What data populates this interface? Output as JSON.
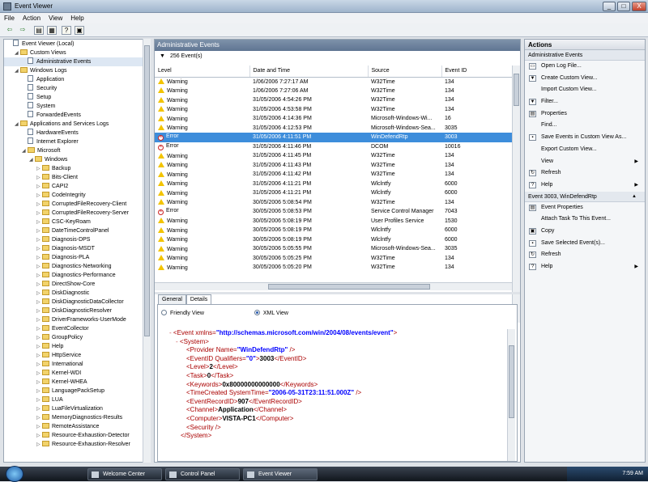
{
  "window": {
    "title": "Event Viewer",
    "minimize": "_",
    "maximize": "□",
    "close": "X"
  },
  "menu": [
    "File",
    "Action",
    "View",
    "Help"
  ],
  "toolbar": {
    "back": "⇦",
    "forward": "⇨",
    "b1": "▤",
    "b2": "▦",
    "b3": "?",
    "b4": "▣"
  },
  "tree": [
    {
      "label": "Event Viewer (Local)",
      "indent": 0,
      "exp": "",
      "kind": "log"
    },
    {
      "label": "Custom Views",
      "indent": 1,
      "exp": "◢",
      "kind": "folder"
    },
    {
      "label": "Administrative Events",
      "indent": 2,
      "exp": "",
      "kind": "log",
      "selected": true
    },
    {
      "label": "Windows Logs",
      "indent": 1,
      "exp": "◢",
      "kind": "folder"
    },
    {
      "label": "Application",
      "indent": 2,
      "exp": "",
      "kind": "log"
    },
    {
      "label": "Security",
      "indent": 2,
      "exp": "",
      "kind": "log"
    },
    {
      "label": "Setup",
      "indent": 2,
      "exp": "",
      "kind": "log"
    },
    {
      "label": "System",
      "indent": 2,
      "exp": "",
      "kind": "log"
    },
    {
      "label": "ForwardedEvents",
      "indent": 2,
      "exp": "",
      "kind": "log"
    },
    {
      "label": "Applications and Services Logs",
      "indent": 1,
      "exp": "◢",
      "kind": "folder"
    },
    {
      "label": "HardwareEvents",
      "indent": 2,
      "exp": "",
      "kind": "log"
    },
    {
      "label": "Internet Explorer",
      "indent": 2,
      "exp": "",
      "kind": "log"
    },
    {
      "label": "Microsoft",
      "indent": 2,
      "exp": "◢",
      "kind": "folder"
    },
    {
      "label": "Windows",
      "indent": 3,
      "exp": "◢",
      "kind": "folder"
    },
    {
      "label": "Backup",
      "indent": 4,
      "exp": "▷",
      "kind": "folder"
    },
    {
      "label": "Bits-Client",
      "indent": 4,
      "exp": "▷",
      "kind": "folder"
    },
    {
      "label": "CAPI2",
      "indent": 4,
      "exp": "▷",
      "kind": "folder"
    },
    {
      "label": "CodeIntegrity",
      "indent": 4,
      "exp": "▷",
      "kind": "folder"
    },
    {
      "label": "CorruptedFileRecovery-Client",
      "indent": 4,
      "exp": "▷",
      "kind": "folder"
    },
    {
      "label": "CorruptedFileRecovery-Server",
      "indent": 4,
      "exp": "▷",
      "kind": "folder"
    },
    {
      "label": "CSC-KeyRoam",
      "indent": 4,
      "exp": "▷",
      "kind": "folder"
    },
    {
      "label": "DateTimeControlPanel",
      "indent": 4,
      "exp": "▷",
      "kind": "folder"
    },
    {
      "label": "Diagnosis-DPS",
      "indent": 4,
      "exp": "▷",
      "kind": "folder"
    },
    {
      "label": "Diagnosis-MSDT",
      "indent": 4,
      "exp": "▷",
      "kind": "folder"
    },
    {
      "label": "Diagnosis-PLA",
      "indent": 4,
      "exp": "▷",
      "kind": "folder"
    },
    {
      "label": "Diagnostics-Networking",
      "indent": 4,
      "exp": "▷",
      "kind": "folder"
    },
    {
      "label": "Diagnostics-Performance",
      "indent": 4,
      "exp": "▷",
      "kind": "folder"
    },
    {
      "label": "DirectShow-Core",
      "indent": 4,
      "exp": "▷",
      "kind": "folder"
    },
    {
      "label": "DiskDiagnostic",
      "indent": 4,
      "exp": "▷",
      "kind": "folder"
    },
    {
      "label": "DiskDiagnosticDataCollector",
      "indent": 4,
      "exp": "▷",
      "kind": "folder"
    },
    {
      "label": "DiskDiagnosticResolver",
      "indent": 4,
      "exp": "▷",
      "kind": "folder"
    },
    {
      "label": "DriverFrameworks-UserMode",
      "indent": 4,
      "exp": "▷",
      "kind": "folder"
    },
    {
      "label": "EventCollector",
      "indent": 4,
      "exp": "▷",
      "kind": "folder"
    },
    {
      "label": "GroupPolicy",
      "indent": 4,
      "exp": "▷",
      "kind": "folder"
    },
    {
      "label": "Help",
      "indent": 4,
      "exp": "▷",
      "kind": "folder"
    },
    {
      "label": "HttpService",
      "indent": 4,
      "exp": "▷",
      "kind": "folder"
    },
    {
      "label": "International",
      "indent": 4,
      "exp": "▷",
      "kind": "folder"
    },
    {
      "label": "Kernel-WDI",
      "indent": 4,
      "exp": "▷",
      "kind": "folder"
    },
    {
      "label": "Kernel-WHEA",
      "indent": 4,
      "exp": "▷",
      "kind": "folder"
    },
    {
      "label": "LanguagePackSetup",
      "indent": 4,
      "exp": "▷",
      "kind": "folder"
    },
    {
      "label": "LUA",
      "indent": 4,
      "exp": "▷",
      "kind": "folder"
    },
    {
      "label": "LuaFileVirtualization",
      "indent": 4,
      "exp": "▷",
      "kind": "folder"
    },
    {
      "label": "MemoryDiagnostics-Results",
      "indent": 4,
      "exp": "▷",
      "kind": "folder"
    },
    {
      "label": "RemoteAssistance",
      "indent": 4,
      "exp": "▷",
      "kind": "folder"
    },
    {
      "label": "Resource-Exhaustion-Detector",
      "indent": 4,
      "exp": "▷",
      "kind": "folder"
    },
    {
      "label": "Resource-Exhaustion-Resolver",
      "indent": 4,
      "exp": "▷",
      "kind": "folder"
    }
  ],
  "center": {
    "title": "Administrative Events",
    "count": "256 Event(s)",
    "columns": [
      "Level",
      "Date and Time",
      "Source",
      "Event ID"
    ],
    "rows": [
      {
        "level": "Warning",
        "type": "warn",
        "date": "1/06/2006 7:27:17 AM",
        "source": "W32Time",
        "id": "134"
      },
      {
        "level": "Warning",
        "type": "warn",
        "date": "1/06/2006 7:27:06 AM",
        "source": "W32Time",
        "id": "134"
      },
      {
        "level": "Warning",
        "type": "warn",
        "date": "31/05/2006 4:54:26 PM",
        "source": "W32Time",
        "id": "134"
      },
      {
        "level": "Warning",
        "type": "warn",
        "date": "31/05/2006 4:53:58 PM",
        "source": "W32Time",
        "id": "134"
      },
      {
        "level": "Warning",
        "type": "warn",
        "date": "31/05/2006 4:14:36 PM",
        "source": "Microsoft-Windows-Wi...",
        "id": "16"
      },
      {
        "level": "Warning",
        "type": "warn",
        "date": "31/05/2006 4:12:53 PM",
        "source": "Microsoft-Windows-Sea...",
        "id": "3035"
      },
      {
        "level": "Error",
        "type": "err",
        "date": "31/05/2006 4:11:51 PM",
        "source": "WinDefendRtp",
        "id": "3003",
        "selected": true
      },
      {
        "level": "Error",
        "type": "err",
        "date": "31/05/2006 4:11:46 PM",
        "source": "DCOM",
        "id": "10016"
      },
      {
        "level": "Warning",
        "type": "warn",
        "date": "31/05/2006 4:11:45 PM",
        "source": "W32Time",
        "id": "134"
      },
      {
        "level": "Warning",
        "type": "warn",
        "date": "31/05/2006 4:11:43 PM",
        "source": "W32Time",
        "id": "134"
      },
      {
        "level": "Warning",
        "type": "warn",
        "date": "31/05/2006 4:11:42 PM",
        "source": "W32Time",
        "id": "134"
      },
      {
        "level": "Warning",
        "type": "warn",
        "date": "31/05/2006 4:11:21 PM",
        "source": "Wlclntfy",
        "id": "6000"
      },
      {
        "level": "Warning",
        "type": "warn",
        "date": "31/05/2006 4:11:21 PM",
        "source": "Wlclntfy",
        "id": "6000"
      },
      {
        "level": "Warning",
        "type": "warn",
        "date": "30/05/2006 5:08:54 PM",
        "source": "W32Time",
        "id": "134"
      },
      {
        "level": "Error",
        "type": "err",
        "date": "30/05/2006 5:08:53 PM",
        "source": "Service Control Manager",
        "id": "7043"
      },
      {
        "level": "Warning",
        "type": "warn",
        "date": "30/05/2006 5:08:19 PM",
        "source": "User Profiles Service",
        "id": "1530"
      },
      {
        "level": "Warning",
        "type": "warn",
        "date": "30/05/2006 5:08:19 PM",
        "source": "Wlclntfy",
        "id": "6000"
      },
      {
        "level": "Warning",
        "type": "warn",
        "date": "30/05/2006 5:08:19 PM",
        "source": "Wlclntfy",
        "id": "6000"
      },
      {
        "level": "Warning",
        "type": "warn",
        "date": "30/05/2006 5:05:55 PM",
        "source": "Microsoft-Windows-Sea...",
        "id": "3035"
      },
      {
        "level": "Warning",
        "type": "warn",
        "date": "30/05/2006 5:05:25 PM",
        "source": "W32Time",
        "id": "134"
      },
      {
        "level": "Warning",
        "type": "warn",
        "date": "30/05/2006 5:05:20 PM",
        "source": "W32Time",
        "id": "134"
      }
    ],
    "tabs": [
      "General",
      "Details"
    ],
    "radio_friendly": "Friendly View",
    "radio_xml": "XML View"
  },
  "xml": {
    "event_open": "<Event",
    "event_attr": " xmlns=",
    "event_ns": "\"http://schemas.microsoft.com/win/2004/08/events/event\"",
    "event_close_bracket": ">",
    "system_open": "<System>",
    "provider_open": "<Provider",
    "provider_attr": " Name=",
    "provider_val": "\"WinDefendRtp\"",
    "provider_end": " />",
    "eventid_open": "<EventID",
    "eventid_attr": " Qualifiers=",
    "eventid_qual": "\"0\"",
    "eventid_gt": ">",
    "eventid_val": "3003",
    "eventid_close": "</EventID>",
    "level_open": "<Level>",
    "level_val": "2",
    "level_close": "</Level>",
    "task_open": "<Task>",
    "task_val": "0",
    "task_close": "</Task>",
    "keywords_open": "<Keywords>",
    "keywords_val": "0x80000000000000",
    "keywords_close": "</Keywords>",
    "time_open": "<TimeCreated",
    "time_attr": " SystemTime=",
    "time_val": "\"2006-05-31T23:11:51.000Z\"",
    "time_end": " />",
    "rec_open": "<EventRecordID>",
    "rec_val": "907",
    "rec_close": "</EventRecordID>",
    "chan_open": "<Channel>",
    "chan_val": "Application",
    "chan_close": "</Channel>",
    "comp_open": "<Computer>",
    "comp_val": "VISTA-PC1",
    "comp_close": "</Computer>",
    "sec": "<Security />",
    "system_close": "</System>",
    "minus": "-"
  },
  "actions": {
    "header": "Actions",
    "section1": "Administrative Events",
    "items1": [
      {
        "label": "Open Log File...",
        "icon": "folder-open-icon",
        "g": "▭"
      },
      {
        "label": "Create Custom View...",
        "icon": "filter-create-icon",
        "g": "▼"
      },
      {
        "label": "Import Custom View...",
        "icon": "",
        "g": ""
      },
      {
        "label": "Filter...",
        "icon": "filter-icon",
        "g": "▼"
      },
      {
        "label": "Properties",
        "icon": "properties-icon",
        "g": "▤"
      },
      {
        "label": "Find...",
        "icon": "",
        "g": ""
      },
      {
        "label": "Save Events in Custom View As...",
        "icon": "save-icon",
        "g": "▪"
      },
      {
        "label": "Export Custom View...",
        "icon": "",
        "g": ""
      },
      {
        "label": "View",
        "icon": "",
        "g": "",
        "arrow": "▶"
      },
      {
        "label": "Refresh",
        "icon": "refresh-icon",
        "g": "↻"
      },
      {
        "label": "Help",
        "icon": "help-icon",
        "g": "?",
        "arrow": "▶"
      }
    ],
    "section2": "Event 3003, WinDefendRtp",
    "items2": [
      {
        "label": "Event Properties",
        "icon": "event-properties-icon",
        "g": "▤"
      },
      {
        "label": "Attach Task To This Event...",
        "icon": "",
        "g": ""
      },
      {
        "label": "Copy",
        "icon": "copy-icon",
        "g": "▣"
      },
      {
        "label": "Save Selected Event(s)...",
        "icon": "save-icon",
        "g": "▪"
      },
      {
        "label": "Refresh",
        "icon": "refresh-icon",
        "g": "↻"
      },
      {
        "label": "Help",
        "icon": "help-icon",
        "g": "?",
        "arrow": "▶"
      }
    ],
    "collapse": "▲"
  },
  "taskbar": {
    "items": [
      "Welcome Center",
      "Control Panel",
      "Event Viewer"
    ],
    "clock": "7:59 AM"
  }
}
